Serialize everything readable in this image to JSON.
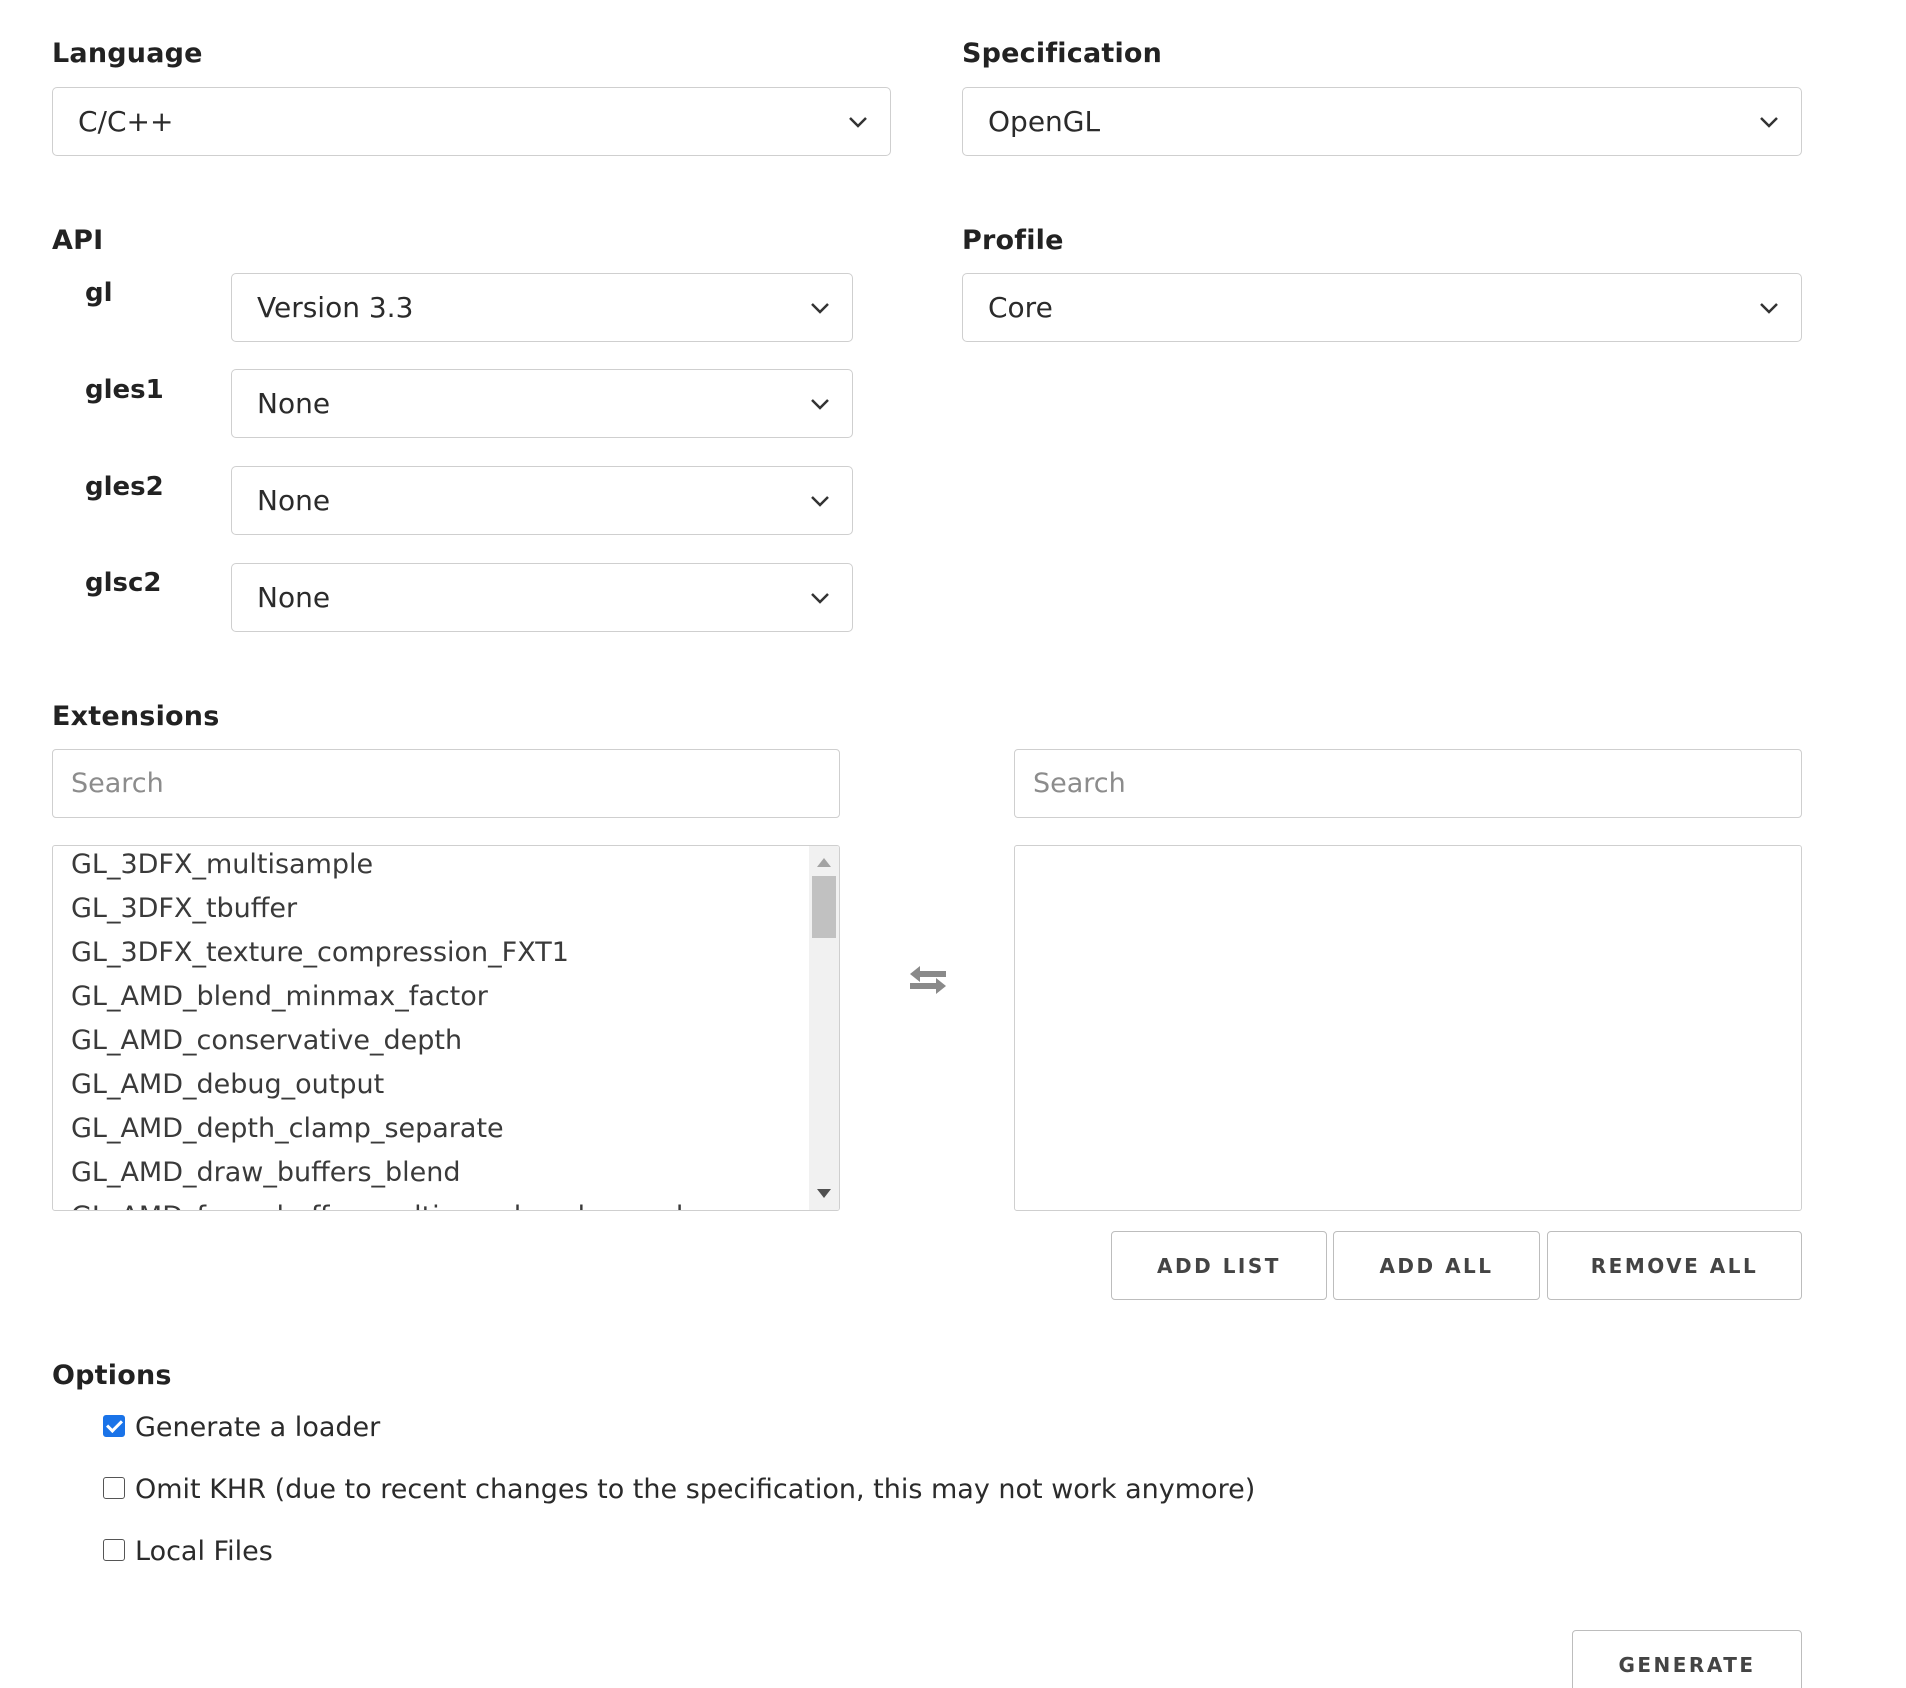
{
  "language": {
    "label": "Language",
    "value": "C/C++"
  },
  "specification": {
    "label": "Specification",
    "value": "OpenGL"
  },
  "api": {
    "label": "API",
    "rows": [
      {
        "name": "gl",
        "value": "Version 3.3"
      },
      {
        "name": "gles1",
        "value": "None"
      },
      {
        "name": "gles2",
        "value": "None"
      },
      {
        "name": "glsc2",
        "value": "None"
      }
    ]
  },
  "profile": {
    "label": "Profile",
    "value": "Core"
  },
  "extensions": {
    "label": "Extensions",
    "left_search_placeholder": "Search",
    "right_search_placeholder": "Search",
    "available": [
      "GL_3DFX_multisample",
      "GL_3DFX_tbuffer",
      "GL_3DFX_texture_compression_FXT1",
      "GL_AMD_blend_minmax_factor",
      "GL_AMD_conservative_depth",
      "GL_AMD_debug_output",
      "GL_AMD_depth_clamp_separate",
      "GL_AMD_draw_buffers_blend",
      "GL_AMD_framebuffer_multisample_advanced"
    ],
    "selected": [],
    "buttons": {
      "add_list": "ADD LIST",
      "add_all": "ADD ALL",
      "remove_all": "REMOVE ALL"
    }
  },
  "options": {
    "label": "Options",
    "items": [
      {
        "label": "Generate a loader",
        "checked": true
      },
      {
        "label": "Omit KHR (due to recent changes to the specification, this may not work anymore)",
        "checked": false
      },
      {
        "label": "Local Files",
        "checked": false
      }
    ]
  },
  "generate_label": "GENERATE",
  "colors": {
    "accent": "#1a73e8",
    "border": "#cfcfcf",
    "icon": "#8a8a8a"
  }
}
